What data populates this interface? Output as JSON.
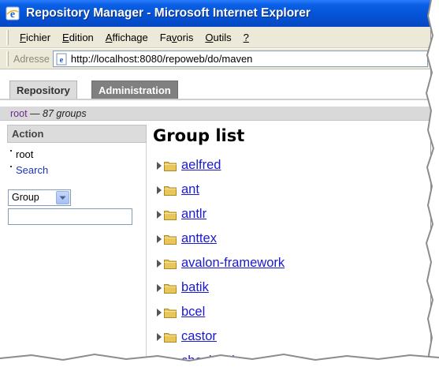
{
  "window": {
    "title": "Repository Manager - Microsoft Internet Explorer"
  },
  "menu": {
    "items": [
      {
        "pre": "",
        "ul": "F",
        "post": "ichier"
      },
      {
        "pre": "",
        "ul": "E",
        "post": "dition"
      },
      {
        "pre": "",
        "ul": "A",
        "post": "ffichage"
      },
      {
        "pre": "Fa",
        "ul": "v",
        "post": "oris"
      },
      {
        "pre": "",
        "ul": "O",
        "post": "utils"
      },
      {
        "pre": "",
        "ul": "?",
        "post": ""
      }
    ]
  },
  "address": {
    "label": "Adresse",
    "url": "http://localhost:8080/repoweb/do/maven"
  },
  "tabs": [
    {
      "label": "Repository"
    },
    {
      "label": "Administration"
    }
  ],
  "breadcrumb": {
    "root": "root",
    "rest": " — 87 groups"
  },
  "sidebar": {
    "header": "Action",
    "items": [
      {
        "label": "root"
      },
      {
        "label": "Search"
      }
    ],
    "select_value": "Group",
    "search_value": ""
  },
  "main": {
    "title": "Group list",
    "groups": [
      "aelfred",
      "ant",
      "antlr",
      "anttex",
      "avalon-framework",
      "batik",
      "bcel",
      "castor",
      "checkstyle"
    ]
  },
  "colors": {
    "titlebar": "#0553d6",
    "link": "#1a1acf",
    "tab_active": "#dcdcdc",
    "tab_inactive": "#808080"
  }
}
